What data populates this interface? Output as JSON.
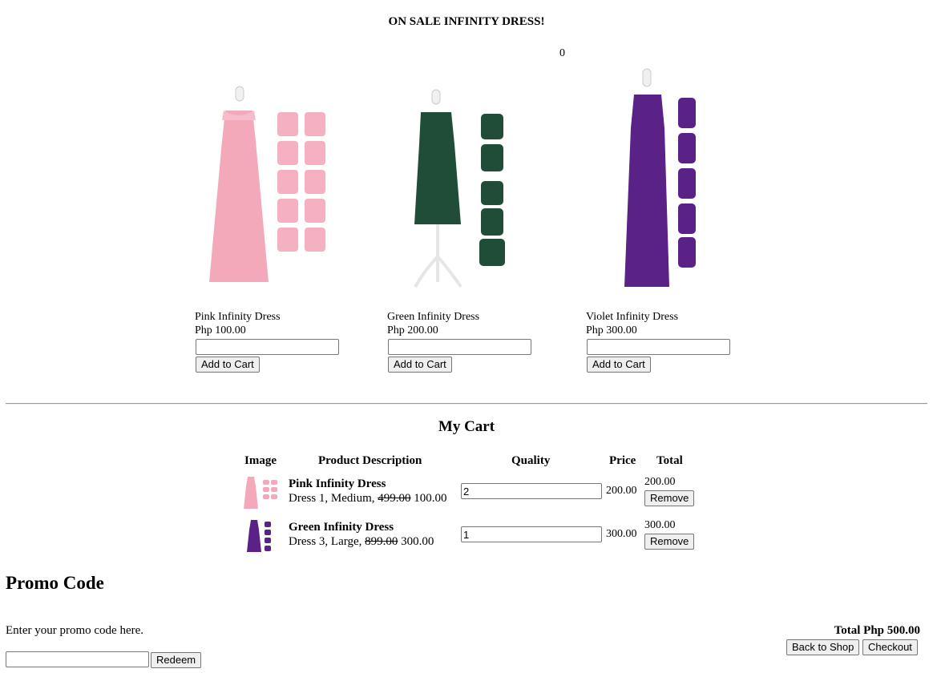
{
  "page": {
    "title": "ON SALE INFINITY DRESS!",
    "cart_count": "0"
  },
  "products": [
    {
      "name": "Pink Infinity Dress",
      "price": "Php 100.00",
      "qty_value": "",
      "add_label": "Add to Cart",
      "color": "#f4a9bb"
    },
    {
      "name": "Green Infinity Dress",
      "price": "Php 200.00",
      "qty_value": "",
      "add_label": "Add to Cart",
      "color": "#1f4d38"
    },
    {
      "name": "Violet Infinity Dress",
      "price": "Php 300.00",
      "qty_value": "",
      "add_label": "Add to Cart",
      "color": "#5a2187"
    }
  ],
  "cart": {
    "title": "My Cart",
    "headers": {
      "image": "Image",
      "description": "Product Description",
      "quantity": "Quality",
      "price": "Price",
      "total": "Total"
    },
    "rows": [
      {
        "name": "Pink Infinity Dress",
        "desc_prefix": "Dress 1, Medium,",
        "old_price": "499.00",
        "new_price": "100.00",
        "qty": "2",
        "price": "200.00",
        "total": "200.00",
        "remove_label": "Remove",
        "color": "#f4a9bb"
      },
      {
        "name": "Green Infinity Dress",
        "desc_prefix": "Dress 3, Large,",
        "old_price": "899.00",
        "new_price": "300.00",
        "qty": "1",
        "price": "300.00",
        "total": "300.00",
        "remove_label": "Remove",
        "color": "#5a2187"
      }
    ]
  },
  "promo": {
    "heading": "Promo Code",
    "text": "Enter your promo code here.",
    "input_value": "",
    "redeem_label": "Redeem"
  },
  "summary": {
    "total_label": "Total Php 500.00",
    "back_label": "Back to Shop",
    "checkout_label": "Checkout"
  }
}
